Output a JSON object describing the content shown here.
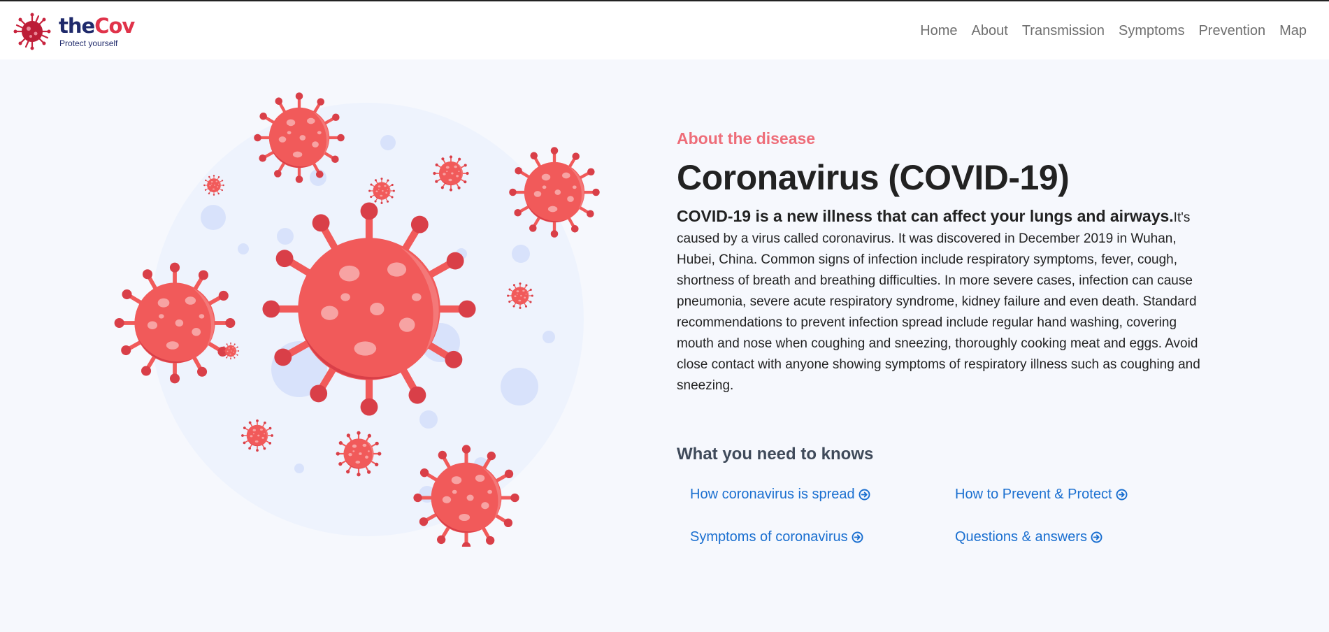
{
  "brand": {
    "name_part1": "the",
    "name_part2": "Cov",
    "tagline": "Protect yourself",
    "logo_icon": "virus-logo-icon"
  },
  "nav": {
    "items": [
      {
        "label": "Home"
      },
      {
        "label": "About"
      },
      {
        "label": "Transmission"
      },
      {
        "label": "Symptoms"
      },
      {
        "label": "Prevention"
      },
      {
        "label": "Map"
      }
    ]
  },
  "about": {
    "eyebrow": "About the disease",
    "title": "Coronavirus (COVID-19)",
    "lead": "COVID-19 is a new illness that can affect your lungs and airways.",
    "body": "It's caused by a virus called coronavirus. It was discovered in December 2019 in Wuhan, Hubei, China. Common signs of infection include respiratory symptoms, fever, cough, shortness of breath and breathing difficulties. In more severe cases, infection can cause pneumonia, severe acute respiratory syndrome, kidney failure and even death. Standard recommendations to prevent infection spread include regular hand washing, covering mouth and nose when coughing and sneezing, thoroughly cooking meat and eggs. Avoid close contact with anyone showing symptoms of respiratory illness such as coughing and sneezing."
  },
  "know": {
    "title": "What you need to knows",
    "links": [
      {
        "label": "How coronavirus is spread",
        "icon": "arrow-circle-right-icon"
      },
      {
        "label": "How to Prevent & Protect",
        "icon": "arrow-circle-right-icon"
      },
      {
        "label": "Symptoms of coronavirus",
        "icon": "arrow-circle-right-icon"
      },
      {
        "label": "Questions & answers",
        "icon": "arrow-circle-right-icon"
      }
    ]
  },
  "colors": {
    "virus": "#f15a5a",
    "virus_dark": "#d93f48",
    "spot": "#f7a3a3",
    "bubble": "#eef3fd",
    "dot": "#d8e2fb",
    "link": "#1a6fd0",
    "eyebrow": "#ee6d79"
  },
  "illustration": {
    "icon": "virus-illustration"
  }
}
